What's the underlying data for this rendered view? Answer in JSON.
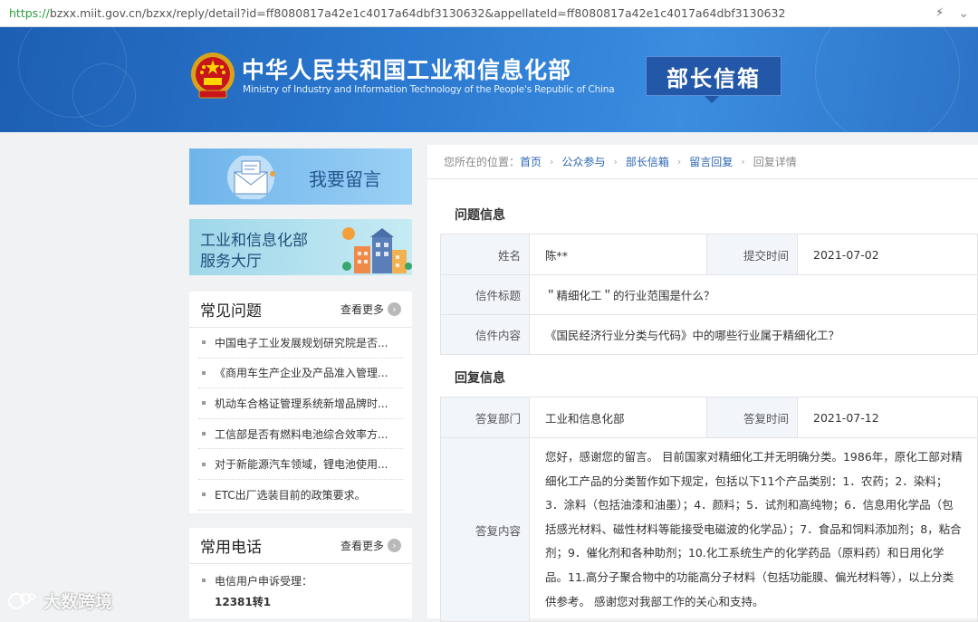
{
  "browser": {
    "url_proto": "https://",
    "url_rest": "bzxx.miit.gov.cn/bzxx/reply/detail?id=ff8080817a42e1c4017a64dbf3130632&appellateId=ff8080817a42e1c4017a64dbf3130632",
    "bolt_glyph": "⚡",
    "chevron_glyph": "⌄"
  },
  "header": {
    "title_cn": "中华人民共和国工业和信息化部",
    "title_en": "Ministry of Industry and Information Technology of the People's Republic of China",
    "mailbox": "部长信箱"
  },
  "sidebar": {
    "leave_message": "我要留言",
    "service_hall_line1": "工业和信息化部",
    "service_hall_line2": "服务大厅",
    "faq": {
      "title": "常见问题",
      "more": "查看更多",
      "items": [
        "中国电子工业发展规划研究院是否...",
        "《商用车生产企业及产品准入管理...",
        "机动车合格证管理系统新增品牌时...",
        "工信部是否有燃料电池综合效率方...",
        "对于新能源汽车领域，锂电池使用...",
        "ETC出厂选装目前的政策要求。"
      ]
    },
    "phones": {
      "title": "常用电话",
      "more": "查看更多",
      "item_label": "电信用户申诉受理：",
      "item_number": "12381转1"
    }
  },
  "breadcrumb": {
    "prefix": "您所在的位置：",
    "links": [
      "首页",
      "公众参与",
      "部长信箱",
      "留言回复"
    ],
    "current": "回复详情",
    "separator": "›"
  },
  "question": {
    "section_title": "问题信息",
    "name_label": "姓名",
    "name_value": "陈**",
    "submit_time_label": "提交时间",
    "submit_time_value": "2021-07-02",
    "subject_label": "信件标题",
    "subject_value": "＂精细化工＂的行业范围是什么？",
    "content_label": "信件内容",
    "content_value": "《国民经济行业分类与代码》中的哪些行业属于精细化工？"
  },
  "reply": {
    "section_title": "回复信息",
    "dept_label": "答复部门",
    "dept_value": "工业和信息化部",
    "time_label": "答复时间",
    "time_value": "2021-07-12",
    "content_label": "答复内容",
    "content_value": "您好，感谢您的留言。 目前国家对精细化工并无明确分类。1986年，原化工部对精细化工产品的分类暂作如下规定，包括以下11个产品类别：1．农药；2．染料；3．涂料（包括油漆和油墨）；4．颜料；5．试剂和高纯物；6．信息用化学品（包括感光材料、磁性材料等能接受电磁波的化学品）；7．食品和饲料添加剂；8，粘合剂；9．催化剂和各种助剂；10.化工系统生产的化学药品（原料药）和日用化学品。11.高分子聚合物中的功能高分子材料（包括功能膜、偏光材料等），以上分类供参考。 感谢您对我部工作的关心和支持。"
  },
  "watermark": {
    "text": "大数跨境"
  },
  "colors": {
    "banner_blue": "#2a78cf",
    "link_blue": "#2b66b3",
    "label_bg": "#f2f6fb",
    "https_green": "#2a9d3e"
  }
}
